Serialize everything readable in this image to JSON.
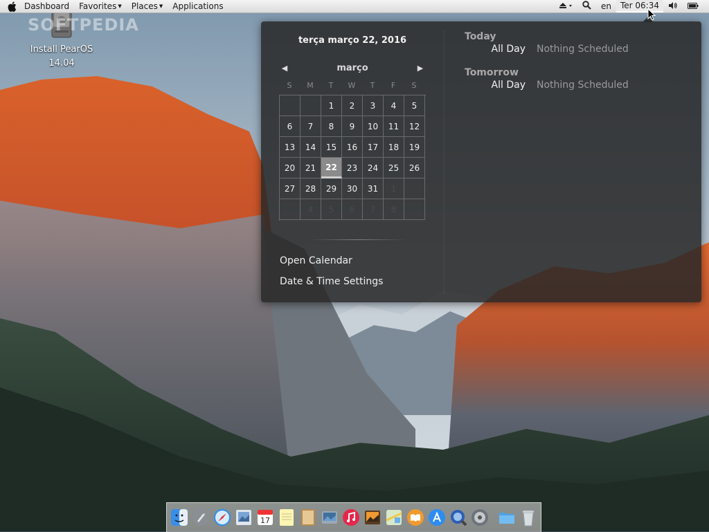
{
  "top_panel": {
    "menus": [
      {
        "label": "Dashboard",
        "has_arrow": false
      },
      {
        "label": "Favorites",
        "has_arrow": true
      },
      {
        "label": "Places",
        "has_arrow": true
      },
      {
        "label": "Applications",
        "has_arrow": false
      }
    ],
    "indicators": {
      "eject": "eject-icon",
      "search": "search-icon",
      "keyboard_layout": "en",
      "clock": "Ter 06:34",
      "volume": "volume-icon",
      "battery": "battery-icon"
    }
  },
  "desktop": {
    "watermark": "SOFTPEDIA",
    "icons": [
      {
        "label_line1": "Install PearOS",
        "label_line2": "14.04",
        "icon": "hard-drive-icon"
      }
    ]
  },
  "calendar_popup": {
    "date_heading": "terça março 22, 2016",
    "month": "março",
    "weekdays": [
      "S",
      "M",
      "T",
      "W",
      "T",
      "F",
      "S"
    ],
    "weeks": [
      [
        {
          "d": "",
          "o": true
        },
        {
          "d": "",
          "o": true
        },
        {
          "d": "1"
        },
        {
          "d": "2"
        },
        {
          "d": "3"
        },
        {
          "d": "4"
        },
        {
          "d": "5"
        }
      ],
      [
        {
          "d": "6"
        },
        {
          "d": "7"
        },
        {
          "d": "8"
        },
        {
          "d": "9"
        },
        {
          "d": "10"
        },
        {
          "d": "11"
        },
        {
          "d": "12"
        }
      ],
      [
        {
          "d": "13"
        },
        {
          "d": "14"
        },
        {
          "d": "15"
        },
        {
          "d": "16"
        },
        {
          "d": "17"
        },
        {
          "d": "18"
        },
        {
          "d": "19"
        }
      ],
      [
        {
          "d": "20"
        },
        {
          "d": "21"
        },
        {
          "d": "22",
          "today": true
        },
        {
          "d": "23"
        },
        {
          "d": "24"
        },
        {
          "d": "25"
        },
        {
          "d": "26"
        }
      ],
      [
        {
          "d": "27"
        },
        {
          "d": "28"
        },
        {
          "d": "29"
        },
        {
          "d": "30"
        },
        {
          "d": "31"
        },
        {
          "d": "1",
          "o": true
        },
        {
          "d": "",
          "o": true
        }
      ],
      [
        {
          "d": "",
          "o": true
        },
        {
          "d": "4",
          "o": true
        },
        {
          "d": "5",
          "o": true
        },
        {
          "d": "6",
          "o": true
        },
        {
          "d": "7",
          "o": true
        },
        {
          "d": "8",
          "o": true
        },
        {
          "d": "",
          "o": true
        }
      ]
    ],
    "actions": {
      "open_calendar": "Open Calendar",
      "date_time_settings": "Date & Time Settings"
    },
    "events": [
      {
        "title": "Today",
        "time": "All Day",
        "text": "Nothing Scheduled"
      },
      {
        "title": "Tomorrow",
        "time": "All Day",
        "text": "Nothing Scheduled"
      }
    ]
  },
  "dock": {
    "items": [
      "finder-icon",
      "launchpad-rocket-icon",
      "safari-icon",
      "preview-icon",
      "calendar-icon",
      "notes-icon",
      "contacts-icon",
      "photos-icon",
      "itunes-icon",
      "gallery-icon",
      "maps-icon",
      "ibooks-icon",
      "app-store-icon",
      "quicktime-icon",
      "system-preferences-icon",
      "folder-icon",
      "trash-icon"
    ],
    "calendar_icon_day": "17"
  }
}
